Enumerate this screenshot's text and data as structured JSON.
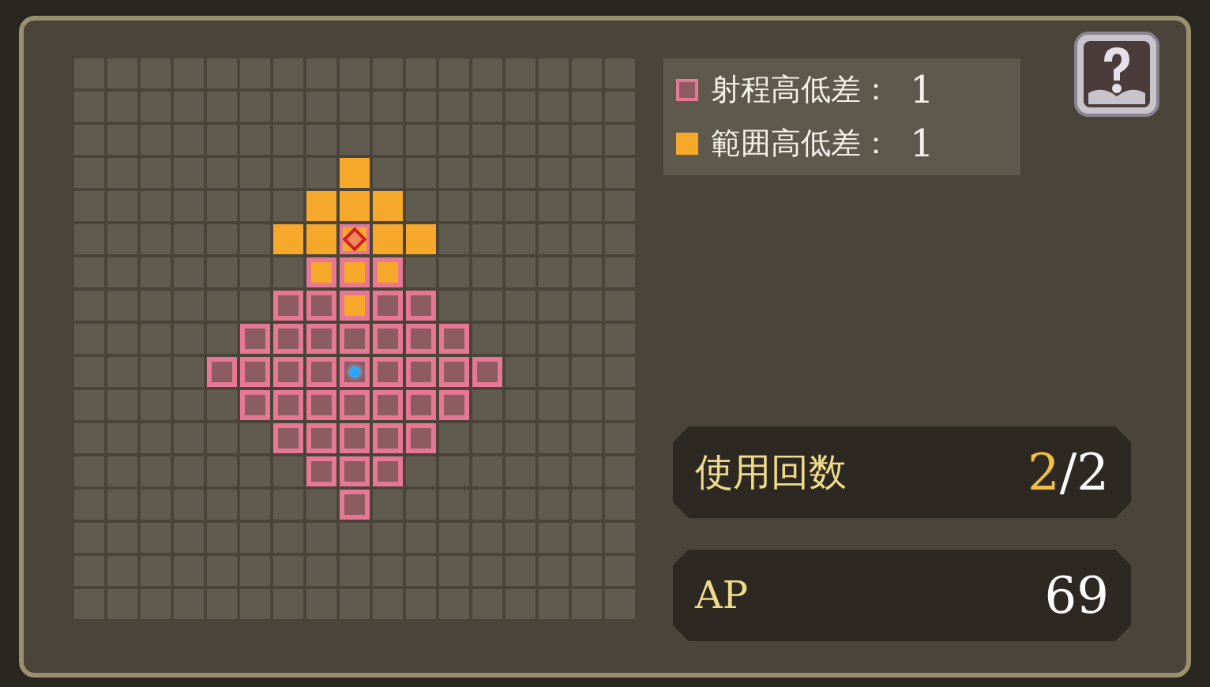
{
  "grid": {
    "rows": [
      [
        {
          "kind": "empty"
        },
        {
          "kind": "empty"
        },
        {
          "kind": "empty"
        },
        {
          "kind": "empty"
        },
        {
          "kind": "empty"
        },
        {
          "kind": "empty"
        },
        {
          "kind": "empty"
        },
        {
          "kind": "empty"
        },
        {
          "kind": "empty"
        },
        {
          "kind": "empty"
        },
        {
          "kind": "empty"
        },
        {
          "kind": "empty"
        },
        {
          "kind": "empty"
        },
        {
          "kind": "empty"
        },
        {
          "kind": "empty"
        },
        {
          "kind": "empty"
        },
        {
          "kind": "empty"
        }
      ],
      [
        {
          "kind": "empty"
        },
        {
          "kind": "empty"
        },
        {
          "kind": "empty"
        },
        {
          "kind": "empty"
        },
        {
          "kind": "empty"
        },
        {
          "kind": "empty"
        },
        {
          "kind": "empty"
        },
        {
          "kind": "empty"
        },
        {
          "kind": "empty"
        },
        {
          "kind": "empty"
        },
        {
          "kind": "empty"
        },
        {
          "kind": "empty"
        },
        {
          "kind": "empty"
        },
        {
          "kind": "empty"
        },
        {
          "kind": "empty"
        },
        {
          "kind": "empty"
        },
        {
          "kind": "empty"
        }
      ],
      [
        {
          "kind": "empty"
        },
        {
          "kind": "empty"
        },
        {
          "kind": "empty"
        },
        {
          "kind": "empty"
        },
        {
          "kind": "empty"
        },
        {
          "kind": "empty"
        },
        {
          "kind": "empty"
        },
        {
          "kind": "empty"
        },
        {
          "kind": "empty"
        },
        {
          "kind": "empty"
        },
        {
          "kind": "empty"
        },
        {
          "kind": "empty"
        },
        {
          "kind": "empty"
        },
        {
          "kind": "empty"
        },
        {
          "kind": "empty"
        },
        {
          "kind": "empty"
        },
        {
          "kind": "empty"
        }
      ],
      [
        {
          "kind": "empty"
        },
        {
          "kind": "empty"
        },
        {
          "kind": "empty"
        },
        {
          "kind": "empty"
        },
        {
          "kind": "empty"
        },
        {
          "kind": "empty"
        },
        {
          "kind": "empty"
        },
        {
          "kind": "empty"
        },
        {
          "kind": "area"
        },
        {
          "kind": "empty"
        },
        {
          "kind": "empty"
        },
        {
          "kind": "empty"
        },
        {
          "kind": "empty"
        },
        {
          "kind": "empty"
        },
        {
          "kind": "empty"
        },
        {
          "kind": "empty"
        },
        {
          "kind": "empty"
        }
      ],
      [
        {
          "kind": "empty"
        },
        {
          "kind": "empty"
        },
        {
          "kind": "empty"
        },
        {
          "kind": "empty"
        },
        {
          "kind": "empty"
        },
        {
          "kind": "empty"
        },
        {
          "kind": "empty"
        },
        {
          "kind": "area"
        },
        {
          "kind": "area"
        },
        {
          "kind": "area"
        },
        {
          "kind": "empty"
        },
        {
          "kind": "empty"
        },
        {
          "kind": "empty"
        },
        {
          "kind": "empty"
        },
        {
          "kind": "empty"
        },
        {
          "kind": "empty"
        },
        {
          "kind": "empty"
        }
      ],
      [
        {
          "kind": "empty"
        },
        {
          "kind": "empty"
        },
        {
          "kind": "empty"
        },
        {
          "kind": "empty"
        },
        {
          "kind": "empty"
        },
        {
          "kind": "empty"
        },
        {
          "kind": "area"
        },
        {
          "kind": "area"
        },
        {
          "kind": "target"
        },
        {
          "kind": "area"
        },
        {
          "kind": "area"
        },
        {
          "kind": "empty"
        },
        {
          "kind": "empty"
        },
        {
          "kind": "empty"
        },
        {
          "kind": "empty"
        },
        {
          "kind": "empty"
        },
        {
          "kind": "empty"
        }
      ],
      [
        {
          "kind": "empty"
        },
        {
          "kind": "empty"
        },
        {
          "kind": "empty"
        },
        {
          "kind": "empty"
        },
        {
          "kind": "empty"
        },
        {
          "kind": "empty"
        },
        {
          "kind": "empty"
        },
        {
          "kind": "both"
        },
        {
          "kind": "both"
        },
        {
          "kind": "both"
        },
        {
          "kind": "empty"
        },
        {
          "kind": "empty"
        },
        {
          "kind": "empty"
        },
        {
          "kind": "empty"
        },
        {
          "kind": "empty"
        },
        {
          "kind": "empty"
        },
        {
          "kind": "empty"
        }
      ],
      [
        {
          "kind": "empty"
        },
        {
          "kind": "empty"
        },
        {
          "kind": "empty"
        },
        {
          "kind": "empty"
        },
        {
          "kind": "empty"
        },
        {
          "kind": "empty"
        },
        {
          "kind": "range"
        },
        {
          "kind": "range"
        },
        {
          "kind": "both"
        },
        {
          "kind": "range"
        },
        {
          "kind": "range"
        },
        {
          "kind": "empty"
        },
        {
          "kind": "empty"
        },
        {
          "kind": "empty"
        },
        {
          "kind": "empty"
        },
        {
          "kind": "empty"
        },
        {
          "kind": "empty"
        }
      ],
      [
        {
          "kind": "empty"
        },
        {
          "kind": "empty"
        },
        {
          "kind": "empty"
        },
        {
          "kind": "empty"
        },
        {
          "kind": "empty"
        },
        {
          "kind": "range"
        },
        {
          "kind": "range"
        },
        {
          "kind": "range"
        },
        {
          "kind": "range"
        },
        {
          "kind": "range"
        },
        {
          "kind": "range"
        },
        {
          "kind": "range"
        },
        {
          "kind": "empty"
        },
        {
          "kind": "empty"
        },
        {
          "kind": "empty"
        },
        {
          "kind": "empty"
        },
        {
          "kind": "empty"
        }
      ],
      [
        {
          "kind": "empty"
        },
        {
          "kind": "empty"
        },
        {
          "kind": "empty"
        },
        {
          "kind": "empty"
        },
        {
          "kind": "range"
        },
        {
          "kind": "range"
        },
        {
          "kind": "range"
        },
        {
          "kind": "range"
        },
        {
          "kind": "caster"
        },
        {
          "kind": "range"
        },
        {
          "kind": "range"
        },
        {
          "kind": "range"
        },
        {
          "kind": "range"
        },
        {
          "kind": "empty"
        },
        {
          "kind": "empty"
        },
        {
          "kind": "empty"
        },
        {
          "kind": "empty"
        }
      ],
      [
        {
          "kind": "empty"
        },
        {
          "kind": "empty"
        },
        {
          "kind": "empty"
        },
        {
          "kind": "empty"
        },
        {
          "kind": "empty"
        },
        {
          "kind": "range"
        },
        {
          "kind": "range"
        },
        {
          "kind": "range"
        },
        {
          "kind": "range"
        },
        {
          "kind": "range"
        },
        {
          "kind": "range"
        },
        {
          "kind": "range"
        },
        {
          "kind": "empty"
        },
        {
          "kind": "empty"
        },
        {
          "kind": "empty"
        },
        {
          "kind": "empty"
        },
        {
          "kind": "empty"
        }
      ],
      [
        {
          "kind": "empty"
        },
        {
          "kind": "empty"
        },
        {
          "kind": "empty"
        },
        {
          "kind": "empty"
        },
        {
          "kind": "empty"
        },
        {
          "kind": "empty"
        },
        {
          "kind": "range"
        },
        {
          "kind": "range"
        },
        {
          "kind": "range"
        },
        {
          "kind": "range"
        },
        {
          "kind": "range"
        },
        {
          "kind": "empty"
        },
        {
          "kind": "empty"
        },
        {
          "kind": "empty"
        },
        {
          "kind": "empty"
        },
        {
          "kind": "empty"
        },
        {
          "kind": "empty"
        }
      ],
      [
        {
          "kind": "empty"
        },
        {
          "kind": "empty"
        },
        {
          "kind": "empty"
        },
        {
          "kind": "empty"
        },
        {
          "kind": "empty"
        },
        {
          "kind": "empty"
        },
        {
          "kind": "empty"
        },
        {
          "kind": "range"
        },
        {
          "kind": "range"
        },
        {
          "kind": "range"
        },
        {
          "kind": "empty"
        },
        {
          "kind": "empty"
        },
        {
          "kind": "empty"
        },
        {
          "kind": "empty"
        },
        {
          "kind": "empty"
        },
        {
          "kind": "empty"
        },
        {
          "kind": "empty"
        }
      ],
      [
        {
          "kind": "empty"
        },
        {
          "kind": "empty"
        },
        {
          "kind": "empty"
        },
        {
          "kind": "empty"
        },
        {
          "kind": "empty"
        },
        {
          "kind": "empty"
        },
        {
          "kind": "empty"
        },
        {
          "kind": "empty"
        },
        {
          "kind": "range"
        },
        {
          "kind": "empty"
        },
        {
          "kind": "empty"
        },
        {
          "kind": "empty"
        },
        {
          "kind": "empty"
        },
        {
          "kind": "empty"
        },
        {
          "kind": "empty"
        },
        {
          "kind": "empty"
        },
        {
          "kind": "empty"
        }
      ],
      [
        {
          "kind": "empty"
        },
        {
          "kind": "empty"
        },
        {
          "kind": "empty"
        },
        {
          "kind": "empty"
        },
        {
          "kind": "empty"
        },
        {
          "kind": "empty"
        },
        {
          "kind": "empty"
        },
        {
          "kind": "empty"
        },
        {
          "kind": "empty"
        },
        {
          "kind": "empty"
        },
        {
          "kind": "empty"
        },
        {
          "kind": "empty"
        },
        {
          "kind": "empty"
        },
        {
          "kind": "empty"
        },
        {
          "kind": "empty"
        },
        {
          "kind": "empty"
        },
        {
          "kind": "empty"
        }
      ],
      [
        {
          "kind": "empty"
        },
        {
          "kind": "empty"
        },
        {
          "kind": "empty"
        },
        {
          "kind": "empty"
        },
        {
          "kind": "empty"
        },
        {
          "kind": "empty"
        },
        {
          "kind": "empty"
        },
        {
          "kind": "empty"
        },
        {
          "kind": "empty"
        },
        {
          "kind": "empty"
        },
        {
          "kind": "empty"
        },
        {
          "kind": "empty"
        },
        {
          "kind": "empty"
        },
        {
          "kind": "empty"
        },
        {
          "kind": "empty"
        },
        {
          "kind": "empty"
        },
        {
          "kind": "empty"
        }
      ],
      [
        {
          "kind": "empty"
        },
        {
          "kind": "empty"
        },
        {
          "kind": "empty"
        },
        {
          "kind": "empty"
        },
        {
          "kind": "empty"
        },
        {
          "kind": "empty"
        },
        {
          "kind": "empty"
        },
        {
          "kind": "empty"
        },
        {
          "kind": "empty"
        },
        {
          "kind": "empty"
        },
        {
          "kind": "empty"
        },
        {
          "kind": "empty"
        },
        {
          "kind": "empty"
        },
        {
          "kind": "empty"
        },
        {
          "kind": "empty"
        },
        {
          "kind": "empty"
        },
        {
          "kind": "empty"
        }
      ]
    ]
  },
  "legend": [
    {
      "kind": "range",
      "label": "射程高低差：",
      "value": "1"
    },
    {
      "kind": "area",
      "label": "範囲高低差：",
      "value": "1"
    }
  ],
  "uses": {
    "label": "使用回数",
    "current": "2",
    "separator": "/",
    "max": "2"
  },
  "ap": {
    "label": "AP",
    "value": "69"
  }
}
